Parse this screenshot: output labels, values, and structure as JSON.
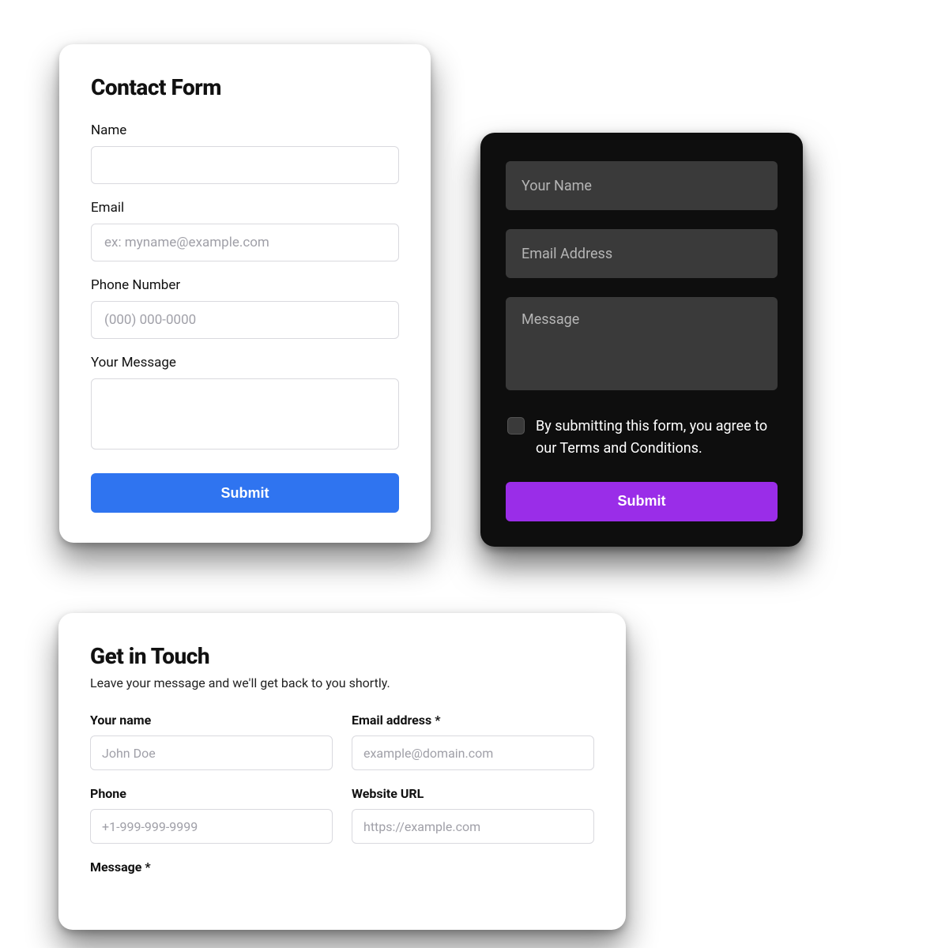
{
  "form1": {
    "title": "Contact Form",
    "name_label": "Name",
    "email_label": "Email",
    "email_placeholder": "ex: myname@example.com",
    "phone_label": "Phone Number",
    "phone_placeholder": "(000) 000-0000",
    "message_label": "Your Message",
    "submit_label": "Submit"
  },
  "form2": {
    "name_placeholder": "Your Name",
    "email_placeholder": "Email Address",
    "message_placeholder": "Message",
    "consent_text": "By submitting this form, you agree to our Terms and Conditions.",
    "submit_label": "Submit"
  },
  "form3": {
    "title": "Get in Touch",
    "subtitle": "Leave your message and we'll get back to you shortly.",
    "name_label": "Your name",
    "name_placeholder": "John Doe",
    "email_label": "Email address *",
    "email_placeholder": "example@domain.com",
    "phone_label": "Phone",
    "phone_placeholder": "+1-999-999-9999",
    "website_label": "Website URL",
    "website_placeholder": "https://example.com",
    "message_label": "Message *"
  }
}
